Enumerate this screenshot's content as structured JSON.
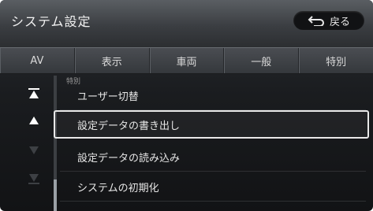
{
  "header": {
    "title": "システム設定",
    "back_label": "戻る"
  },
  "tabs": [
    {
      "label": "AV"
    },
    {
      "label": "表示"
    },
    {
      "label": "車両"
    },
    {
      "label": "一般"
    },
    {
      "label": "特別"
    }
  ],
  "list": {
    "section_label": "特別",
    "items": [
      {
        "label": "ユーザー切替",
        "selected": false
      },
      {
        "label": "設定データの書き出し",
        "selected": true
      },
      {
        "label": "設定データの読み込み",
        "selected": false
      },
      {
        "label": "システムの初期化",
        "selected": false
      }
    ]
  },
  "rail": {
    "icons": [
      "scroll-to-top-icon",
      "scroll-up-icon",
      "scroll-down-icon",
      "scroll-to-bottom-icon"
    ]
  },
  "colors": {
    "highlight_border": "#e8e8e8",
    "text": "#e6e6e6",
    "background": "#1a1c1f"
  }
}
